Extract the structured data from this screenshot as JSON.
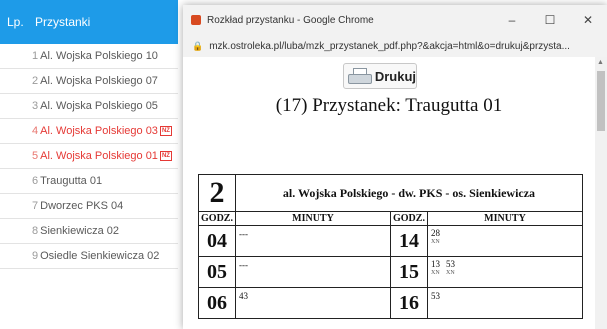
{
  "stops": {
    "header": {
      "lp": "Lp.",
      "title": "Przystanki"
    },
    "items": [
      {
        "num": "1",
        "name": "Al. Wojska Polskiego 10",
        "red": false,
        "badge": ""
      },
      {
        "num": "2",
        "name": "Al. Wojska Polskiego 07",
        "red": false,
        "badge": ""
      },
      {
        "num": "3",
        "name": "Al. Wojska Polskiego 05",
        "red": false,
        "badge": ""
      },
      {
        "num": "4",
        "name": "Al. Wojska Polskiego 03",
        "red": true,
        "badge": "NŻ"
      },
      {
        "num": "5",
        "name": "Al. Wojska Polskiego 01",
        "red": true,
        "badge": "NŻ"
      },
      {
        "num": "6",
        "name": "Traugutta 01",
        "red": false,
        "badge": ""
      },
      {
        "num": "7",
        "name": "Dworzec PKS 04",
        "red": false,
        "badge": ""
      },
      {
        "num": "8",
        "name": "Sienkiewicza 02",
        "red": false,
        "badge": ""
      },
      {
        "num": "9",
        "name": "Osiedle Sienkiewicza 02",
        "red": false,
        "badge": ""
      }
    ]
  },
  "window": {
    "title": "Rozkład przystanku - Google Chrome",
    "url": "mzk.ostroleka.pl/luba/mzk_przystanek_pdf.php?&akcja=html&o=drukuj&przysta...",
    "controls": {
      "minimize": "–",
      "maximize": "☐",
      "close": "✕"
    }
  },
  "page": {
    "print_label": "Drukuj",
    "stop_title": "(17) Przystanek: Traugutta 01",
    "timetable": {
      "line": "2",
      "route": "al. Wojska Polskiego - dw. PKS - os. Sienkiewicza",
      "headers": {
        "hour": "GODZ.",
        "minutes": "MINUTY"
      },
      "rows": [
        {
          "left": {
            "hour": "04",
            "minutes": [
              {
                "m": "---",
                "note": ""
              }
            ]
          },
          "right": {
            "hour": "14",
            "minutes": [
              {
                "m": "28",
                "note": "XN"
              }
            ]
          }
        },
        {
          "left": {
            "hour": "05",
            "minutes": [
              {
                "m": "---",
                "note": ""
              }
            ]
          },
          "right": {
            "hour": "15",
            "minutes": [
              {
                "m": "13",
                "note": "XN"
              },
              {
                "m": "53",
                "note": "XN"
              }
            ]
          }
        },
        {
          "left": {
            "hour": "06",
            "minutes": [
              {
                "m": "43",
                "note": ""
              }
            ]
          },
          "right": {
            "hour": "16",
            "minutes": [
              {
                "m": "53",
                "note": ""
              }
            ]
          }
        }
      ]
    }
  },
  "colors": {
    "accent": "#1e9be8",
    "red": "#e53935"
  }
}
